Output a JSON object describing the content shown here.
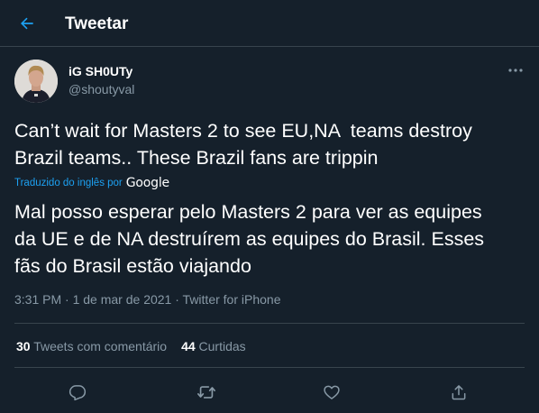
{
  "header": {
    "title": "Tweetar",
    "back_icon": "arrow-left-icon"
  },
  "tweet": {
    "author": {
      "display_name": "iG SH0UTy",
      "handle": "@shoutyval"
    },
    "text": "Can’t wait for Masters 2 to see EU,NA  teams destroy\nBrazil teams.. These Brazil fans are trippin",
    "translation": {
      "label": "Traduzido do inglês por",
      "provider": "Google",
      "text": "Mal posso esperar pelo Masters 2 para ver as equipes\nda UE e de NA destruírem as equipes do Brasil. Esses\nfãs do Brasil estão viajando"
    },
    "meta": {
      "time": "3:31 PM",
      "separator": " · ",
      "date": "1 de mar de 2021",
      "source": "Twitter for iPhone"
    },
    "stats": {
      "quote_count": "30",
      "quote_label": "Tweets com comentário",
      "retweet_count": "44",
      "retweet_label": "Curtidas"
    },
    "actions": [
      "reply-icon",
      "retweet-icon",
      "like-icon",
      "share-icon"
    ]
  },
  "colors": {
    "background": "#15202b",
    "accent": "#1da1f2",
    "secondary_text": "#8899a6",
    "border": "#38444d"
  }
}
